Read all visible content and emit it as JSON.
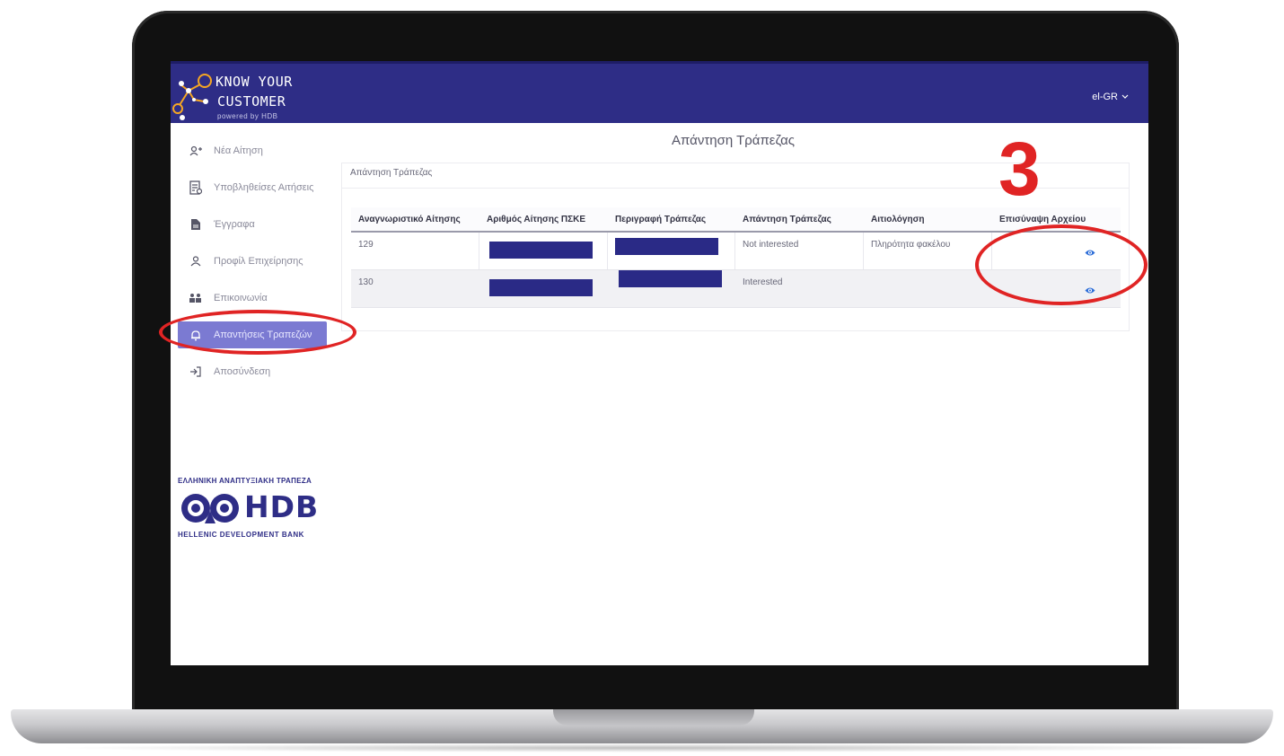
{
  "header": {
    "logo_line1": "KNOW YOUR",
    "logo_line2": "CUSTOMER",
    "logo_line3": "powered by HDB",
    "language": "el-GR"
  },
  "sidebar": {
    "items": [
      {
        "label": "Νέα Αίτηση",
        "icon": "add-user-icon"
      },
      {
        "label": "Υποβληθείσες Αιτήσεις",
        "icon": "document-list-icon"
      },
      {
        "label": "Έγγραφα",
        "icon": "file-icon"
      },
      {
        "label": "Προφίλ Επιχείρησης",
        "icon": "user-icon"
      },
      {
        "label": "Επικοινωνία",
        "icon": "people-icon"
      },
      {
        "label": "Απαντήσεις Τραπεζών",
        "icon": "bell-icon",
        "active": true
      },
      {
        "label": "Αποσύνδεση",
        "icon": "logout-icon"
      }
    ],
    "bank_top": "ΕΛΛΗΝΙΚΗ ΑΝΑΠΤΥΞΙΑΚΗ ΤΡΑΠΕΖΑ",
    "bank_name": "HDB",
    "bank_bottom": "HELLENIC DEVELOPMENT BANK"
  },
  "main": {
    "page_title": "Απάντηση Τράπεζας",
    "card_title": "Απάντηση Τράπεζας",
    "columns": [
      "Αναγνωριστικό Αίτησης",
      "Αριθμός Αίτησης ΠΣΚΕ",
      "Περιγραφή Τράπεζας",
      "Απάντηση Τράπεζας",
      "Αιτιολόγηση",
      "Επισύναψη Αρχείου"
    ],
    "rows": [
      {
        "id": "129",
        "response": "Not interested",
        "reason": "Πληρότητα φακέλου"
      },
      {
        "id": "130",
        "response": "Interested",
        "reason": ""
      }
    ]
  },
  "annotation": {
    "step_number": "3",
    "color": "#e02424"
  },
  "colors": {
    "brand": "#2e2d86",
    "active_nav": "#7b7ad2",
    "redaction": "#2a2a86"
  }
}
